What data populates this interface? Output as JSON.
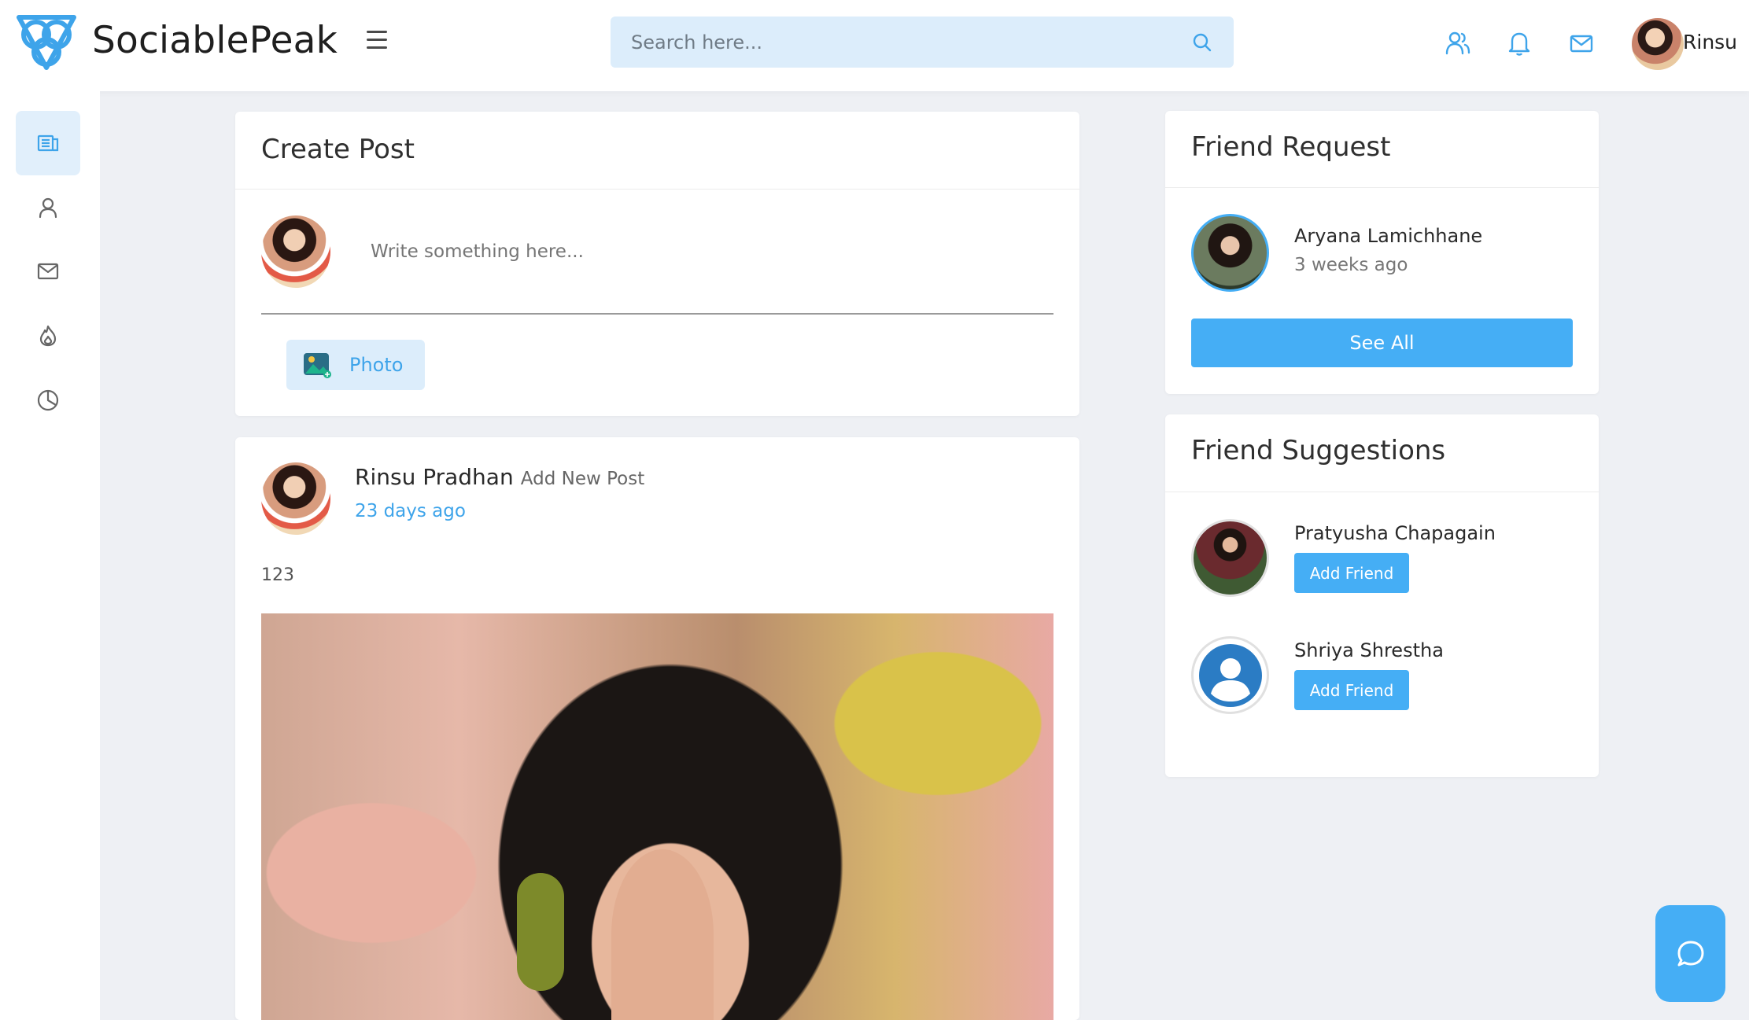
{
  "header": {
    "brand": "SociablePeak",
    "search_placeholder": "Search here...",
    "user_name": "Rinsu",
    "icons": [
      "friends-icon",
      "bell-icon",
      "mail-icon"
    ],
    "accent_color": "#3ea4ea"
  },
  "sidebar": {
    "items": [
      {
        "icon": "newsfeed-icon",
        "active": true
      },
      {
        "icon": "user-icon",
        "active": false
      },
      {
        "icon": "mail-icon",
        "active": false
      },
      {
        "icon": "fire-icon",
        "active": false
      },
      {
        "icon": "pie-chart-icon",
        "active": false
      }
    ]
  },
  "create_post": {
    "title": "Create Post",
    "placeholder": "Write something here...",
    "photo_label": "Photo"
  },
  "post": {
    "author": "Rinsu Pradhan",
    "action": "Add New Post",
    "time": "23 days ago",
    "text": "123"
  },
  "friend_request": {
    "title": "Friend Request",
    "name": "Aryana Lamichhane",
    "time": "3 weeks ago",
    "see_all_label": "See All"
  },
  "friend_suggestions": {
    "title": "Friend Suggestions",
    "items": [
      {
        "name": "Pratyusha Chapagain",
        "button": "Add Friend"
      },
      {
        "name": "Shriya Shrestha",
        "button": "Add Friend"
      }
    ]
  },
  "chat": {
    "icon": "chat-bubble-icon"
  }
}
